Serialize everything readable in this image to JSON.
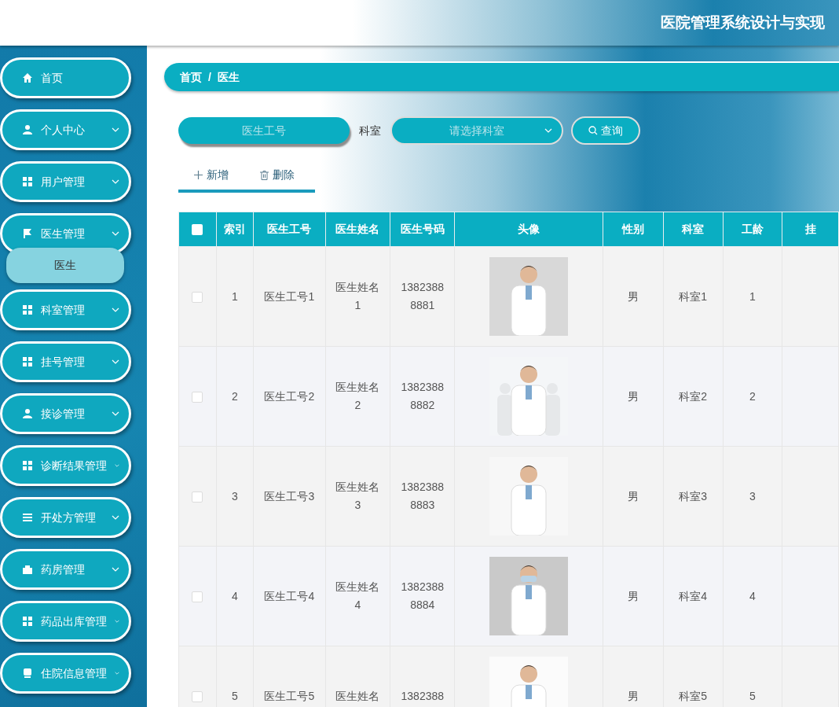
{
  "header": {
    "title": "医院管理系统设计与实现"
  },
  "sidebar": {
    "items": [
      {
        "label": "首页",
        "kind": "link"
      },
      {
        "label": "个人中心",
        "kind": "menu"
      },
      {
        "label": "用户管理",
        "kind": "menu"
      },
      {
        "label": "医生管理",
        "kind": "menu",
        "children": [
          {
            "label": "医生",
            "selected": true
          }
        ]
      },
      {
        "label": "科室管理",
        "kind": "menu"
      },
      {
        "label": "挂号管理",
        "kind": "menu"
      },
      {
        "label": "接诊管理",
        "kind": "menu"
      },
      {
        "label": "诊断结果管理",
        "kind": "menu"
      },
      {
        "label": "开处方管理",
        "kind": "menu"
      },
      {
        "label": "药房管理",
        "kind": "menu"
      },
      {
        "label": "药品出库管理",
        "kind": "menu"
      },
      {
        "label": "住院信息管理",
        "kind": "menu"
      }
    ]
  },
  "breadcrumb": {
    "separator": "/",
    "items": [
      "首页",
      "医生"
    ]
  },
  "search": {
    "id_field": {
      "placeholder": "医生工号"
    },
    "dept_label": "科室",
    "dept_select": {
      "placeholder": "请选择科室"
    },
    "query_button": "查询"
  },
  "actions": [
    {
      "label": "新增",
      "kind": "add"
    },
    {
      "label": "删除",
      "kind": "delete"
    }
  ],
  "table": {
    "select_all": {
      "checked": false
    },
    "columns": [
      "索引",
      "医生工号",
      "医生姓名",
      "医生号码",
      "头像",
      "性别",
      "科室",
      "工龄",
      "挂"
    ],
    "rows": [
      {
        "checked": false,
        "index": "1",
        "staff_no": "医生工号1",
        "name": "医生姓名1",
        "phone": "13823888881",
        "gender": "男",
        "dept": "科室1",
        "years": "1"
      },
      {
        "checked": false,
        "index": "2",
        "staff_no": "医生工号2",
        "name": "医生姓名2",
        "phone": "13823888882",
        "gender": "男",
        "dept": "科室2",
        "years": "2"
      },
      {
        "checked": false,
        "index": "3",
        "staff_no": "医生工号3",
        "name": "医生姓名3",
        "phone": "13823888883",
        "gender": "男",
        "dept": "科室3",
        "years": "3"
      },
      {
        "checked": false,
        "index": "4",
        "staff_no": "医生工号4",
        "name": "医生姓名4",
        "phone": "13823888884",
        "gender": "男",
        "dept": "科室4",
        "years": "4"
      },
      {
        "checked": false,
        "index": "5",
        "staff_no": "医生工号5",
        "name": "医生姓名",
        "phone": "1382388",
        "gender": "男",
        "dept": "科室5",
        "years": "5"
      }
    ]
  }
}
